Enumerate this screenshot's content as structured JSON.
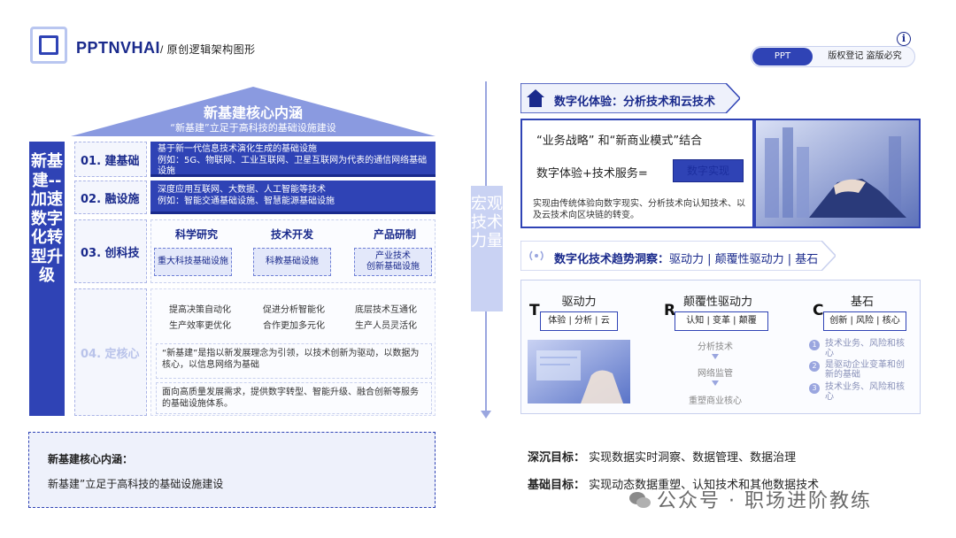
{
  "header": {
    "brand": "PPTNVHAI",
    "brand_sub": "/ 原创逻辑架构图形",
    "pill_left": "PPT",
    "pill_right": "版权登记 盗版必究",
    "info_icon": "i"
  },
  "left": {
    "roof_title": "新基建核心内涵",
    "roof_sub": "“新基建”立足于高科技的基础设施建设",
    "vertical_banner": "新基建--加速数字化转型升级",
    "rows": [
      {
        "label": "01.  建基础",
        "text": "基于新一代信息技术演化生成的基础设施\n例如：5G、物联网、工业互联网、卫星互联网为代表的通信网络基础设施"
      },
      {
        "label": "02.  融设施",
        "text": "深度应用互联网、大数据、人工智能等技术\n例如：智能交通基础设施、智慧能源基础设施"
      },
      {
        "label": "03.  创科技"
      },
      {
        "label": "04.  定核心"
      }
    ],
    "row3": {
      "headers": [
        "科学研究",
        "技术开发",
        "产品研制"
      ],
      "items": [
        "重大科技基础设施",
        "科教基础设施",
        "产业技术\n创新基础设施"
      ]
    },
    "row4": {
      "cells": [
        "提高决策自动化\n生产效率更优化",
        "促进分析智能化\n合作更加多元化",
        "底层技术互通化\n生产人员灵活化"
      ],
      "text1": "“新基建”是指以新发展理念为引领，以技术创新为驱动，以数据为核心，以信息网络为基础",
      "text2": "面向高质量发展需求，提供数字转型、智能升级、融合创新等服务的基础设施体系。"
    },
    "bottom_title": "新基建核心内涵：",
    "bottom_text": "新基建”立足于高科技的基础设施建设"
  },
  "middle": {
    "axis_label": "宏观技术力量"
  },
  "right": {
    "head1": "数字化体验：分析技术和云技术",
    "p1_line1": "“业务战略” 和“新商业模式”结合",
    "p1_line2": "数字体验+技术服务=",
    "p1_button": "数字实现",
    "p1_note": "实现由传统体验向数字现实、分析技术向认知技术、以及云技术向区块链的转变。",
    "head2_bold": "数字化技术趋势洞察：",
    "head2_rest": "驱动力 | 颠覆性驱动力 | 基石",
    "columns": [
      {
        "title": "驱动力",
        "letter": "T",
        "box": "体验 | 分析 | 云"
      },
      {
        "title": "颠覆性驱动力",
        "letter": "R",
        "box": "认知 | 变革 | 颠覆"
      },
      {
        "title": "基石",
        "letter": "C",
        "box": "创新 | 风险 | 核心"
      }
    ],
    "flow": [
      "分析技术",
      "网络监管",
      "重塑商业核心"
    ],
    "numbered": [
      {
        "n": "1",
        "text": "技术业务、风险和核心"
      },
      {
        "n": "2",
        "text": "是驱动企业变革和创新的基础"
      },
      {
        "n": "3",
        "text": "技术业务、风险和核心"
      }
    ],
    "goals": [
      {
        "label": "深沉目标：",
        "text": "实现数据实时洞察、数据管理、数据治理"
      },
      {
        "label": "基础目标：",
        "text": "实现动态数据重塑、认知技术和其他数据技术"
      }
    ]
  },
  "watermark": "公众号 · 职场进阶教练",
  "colors": {
    "primary": "#2f43b5",
    "dark": "#1a2a8c",
    "light": "#c9d2f3"
  }
}
